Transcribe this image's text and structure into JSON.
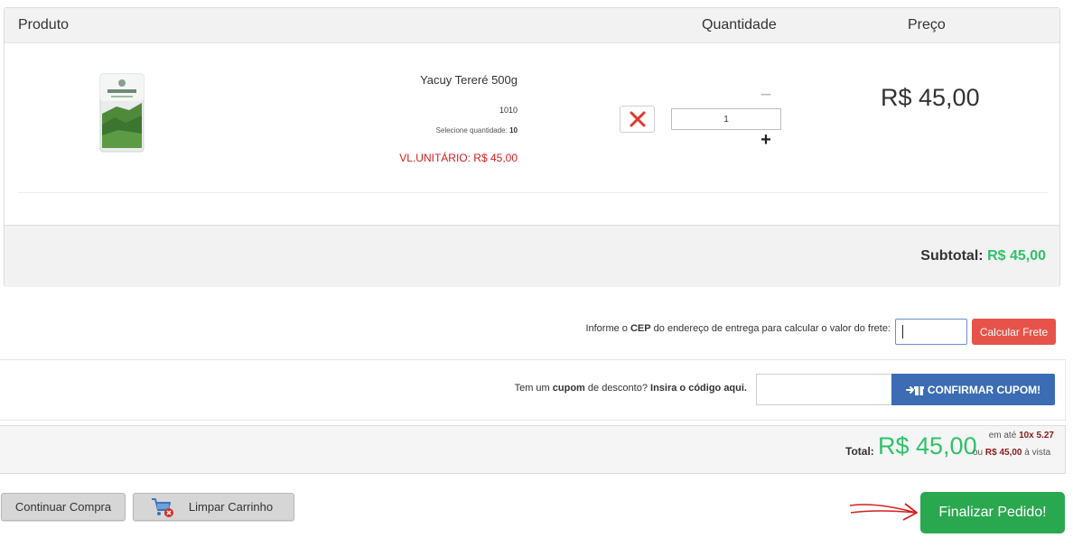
{
  "cart": {
    "headers": {
      "produto": "Produto",
      "quantidade": "Quantidade",
      "preco": "Preço"
    },
    "item": {
      "name": "Yacuy Tereré 500g",
      "code": "1010",
      "select_qty_label": "Selecione quantidade:",
      "select_qty_value": "10",
      "unit_price": "VL.UNITÁRIO: R$ 45,00",
      "quantity": "1",
      "price": "R$ 45,00",
      "image_icon": "yerba-package-image"
    },
    "subtotal_label": "Subtotal:",
    "subtotal_value": "R$ 45,00"
  },
  "frete": {
    "label_pre": "Informe o",
    "label_bold": "CEP",
    "label_post": "do endereço de entrega para calcular o valor do frete:",
    "cep_value": "",
    "button": "Calcular Frete"
  },
  "cupom": {
    "label_pre": "Tem um",
    "label_bold1": "cupom",
    "label_mid": "de desconto?",
    "label_bold2": "Insira o código aqui.",
    "code_value": "",
    "button": "CONFIRMAR CUPOM!",
    "button_icon": "gift-arrow-icon"
  },
  "total": {
    "label": "Total:",
    "value": "R$ 45,00",
    "parc_pre": "em até",
    "parc_value": "10x 5.27",
    "avista_pre": "ou",
    "avista_value": "R$ 45,00",
    "avista_post": "à vista"
  },
  "actions": {
    "continuar": "Continuar Compra",
    "limpar": "Limpar Carrinho",
    "limpar_icon": "cart-remove-icon",
    "finalizar": "Finalizar Pedido!"
  },
  "colors": {
    "green": "#2ec36a",
    "red": "#e7534a",
    "blue": "#3b6cb4",
    "dark_red": "#8b1a1a",
    "finalizar_green": "#2aa84f"
  }
}
